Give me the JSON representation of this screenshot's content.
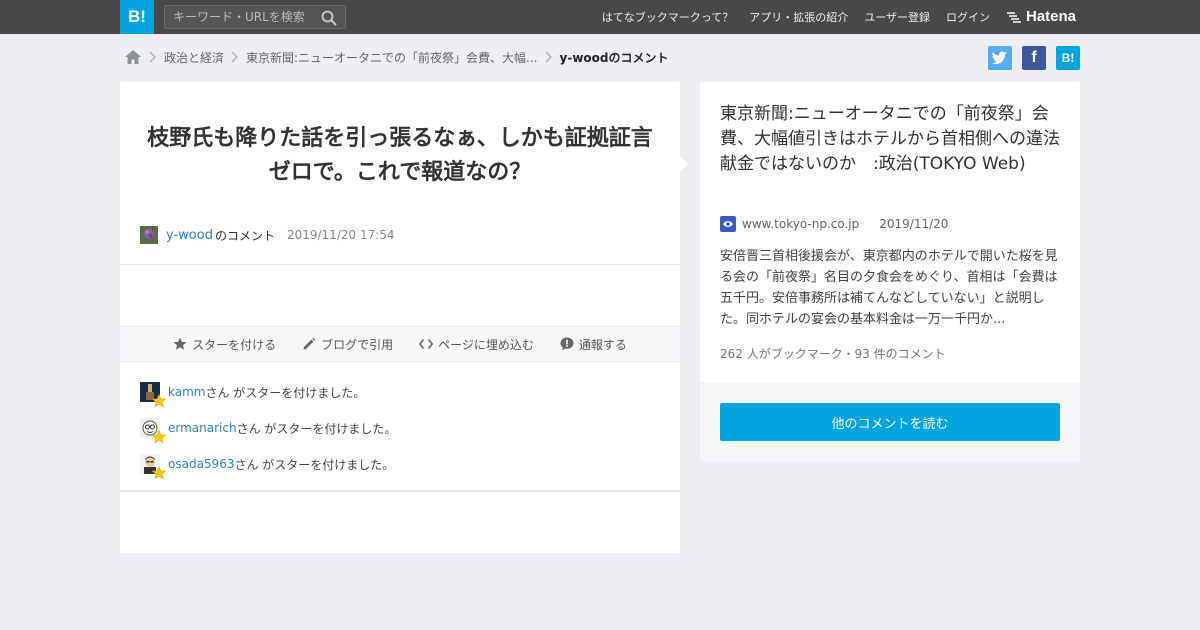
{
  "header": {
    "logo_text": "B!",
    "search_placeholder": "キーワード・URLを検索",
    "nav": [
      "はてなブックマークって？",
      "アプリ・拡張の紹介",
      "ユーザー登録",
      "ログイン"
    ],
    "brand": "Hatena"
  },
  "breadcrumb": {
    "items": [
      "政治と経済",
      "東京新聞:ニューオータニでの「前夜祭」会費、大幅...",
      "y-woodのコメント"
    ]
  },
  "share": {
    "twitter": "t",
    "facebook": "f",
    "hatena": "B!"
  },
  "comment": {
    "text": "枝野氏も降りた話を引っ張るなぁ、しかも証拠証言ゼロで。これで報道なの？",
    "user": "y-wood",
    "suffix": "のコメント",
    "date": "2019/11/20 17:54"
  },
  "toolbar": {
    "star": "スターを付ける",
    "blog": "ブログで引用",
    "embed": "ページに埋め込む",
    "report": "通報する"
  },
  "stars": [
    {
      "user": "kamm",
      "text": "さん がスターを付けました。"
    },
    {
      "user": "ermanarich",
      "text": "さん がスターを付けました。"
    },
    {
      "user": "osada5963",
      "text": "さん がスターを付けました。"
    }
  ],
  "entry": {
    "title": "東京新聞:ニューオータニでの「前夜祭」会費、大幅値引きはホテルから首相側への違法献金ではないのか　:政治(TOKYO Web)",
    "domain": "www.tokyo-np.co.jp",
    "date": "2019/11/20",
    "summary": "安倍晋三首相後援会が、東京都内のホテルで開いた桜を見る会の「前夜祭」名目の夕食会をめぐり、首相は「会費は五千円。安倍事務所は補てんなどしていない」と説明した。同ホテルの宴会の基本料金は一万一千円か...",
    "counts": "262 人がブックマーク・93 件のコメント",
    "read_button": "他のコメントを読む"
  },
  "colors": {
    "accent": "#00a4de",
    "topbar": "#484848",
    "link": "#2d86c6"
  }
}
